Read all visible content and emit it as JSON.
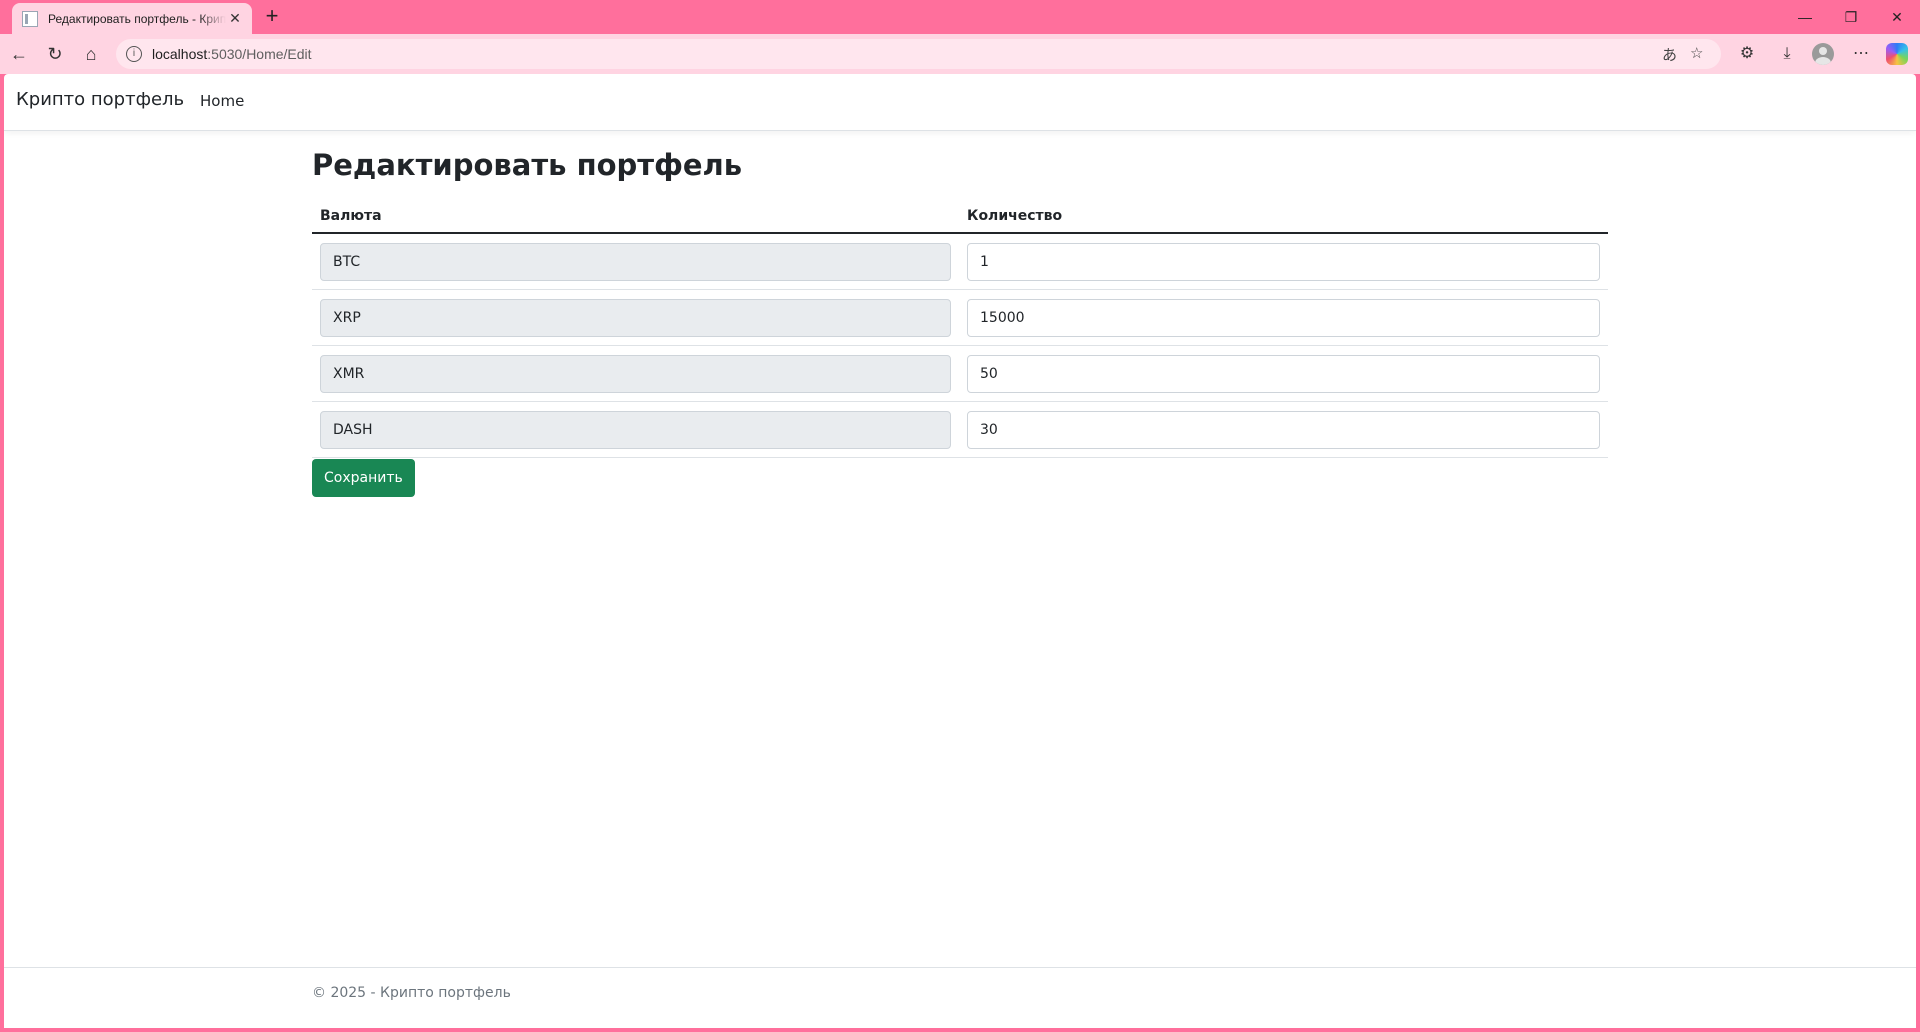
{
  "browser": {
    "tab_title": "Редактировать портфель - Крипто портфель",
    "url_host": "localhost",
    "url_path": ":5030/Home/Edit"
  },
  "navbar": {
    "brand": "Крипто портфель",
    "links": [
      "Home"
    ]
  },
  "main": {
    "title": "Редактировать портфель",
    "columns": [
      "Валюта",
      "Количество"
    ],
    "rows": [
      {
        "currency": "BTC",
        "amount": "1"
      },
      {
        "currency": "XRP",
        "amount": "15000"
      },
      {
        "currency": "XMR",
        "amount": "50"
      },
      {
        "currency": "DASH",
        "amount": "30"
      }
    ],
    "save_label": "Сохранить"
  },
  "footer": {
    "text": "© 2025 - Крипто портфель"
  },
  "colors": {
    "browser_frame": "#ff6f9c",
    "save_button": "#198754"
  }
}
